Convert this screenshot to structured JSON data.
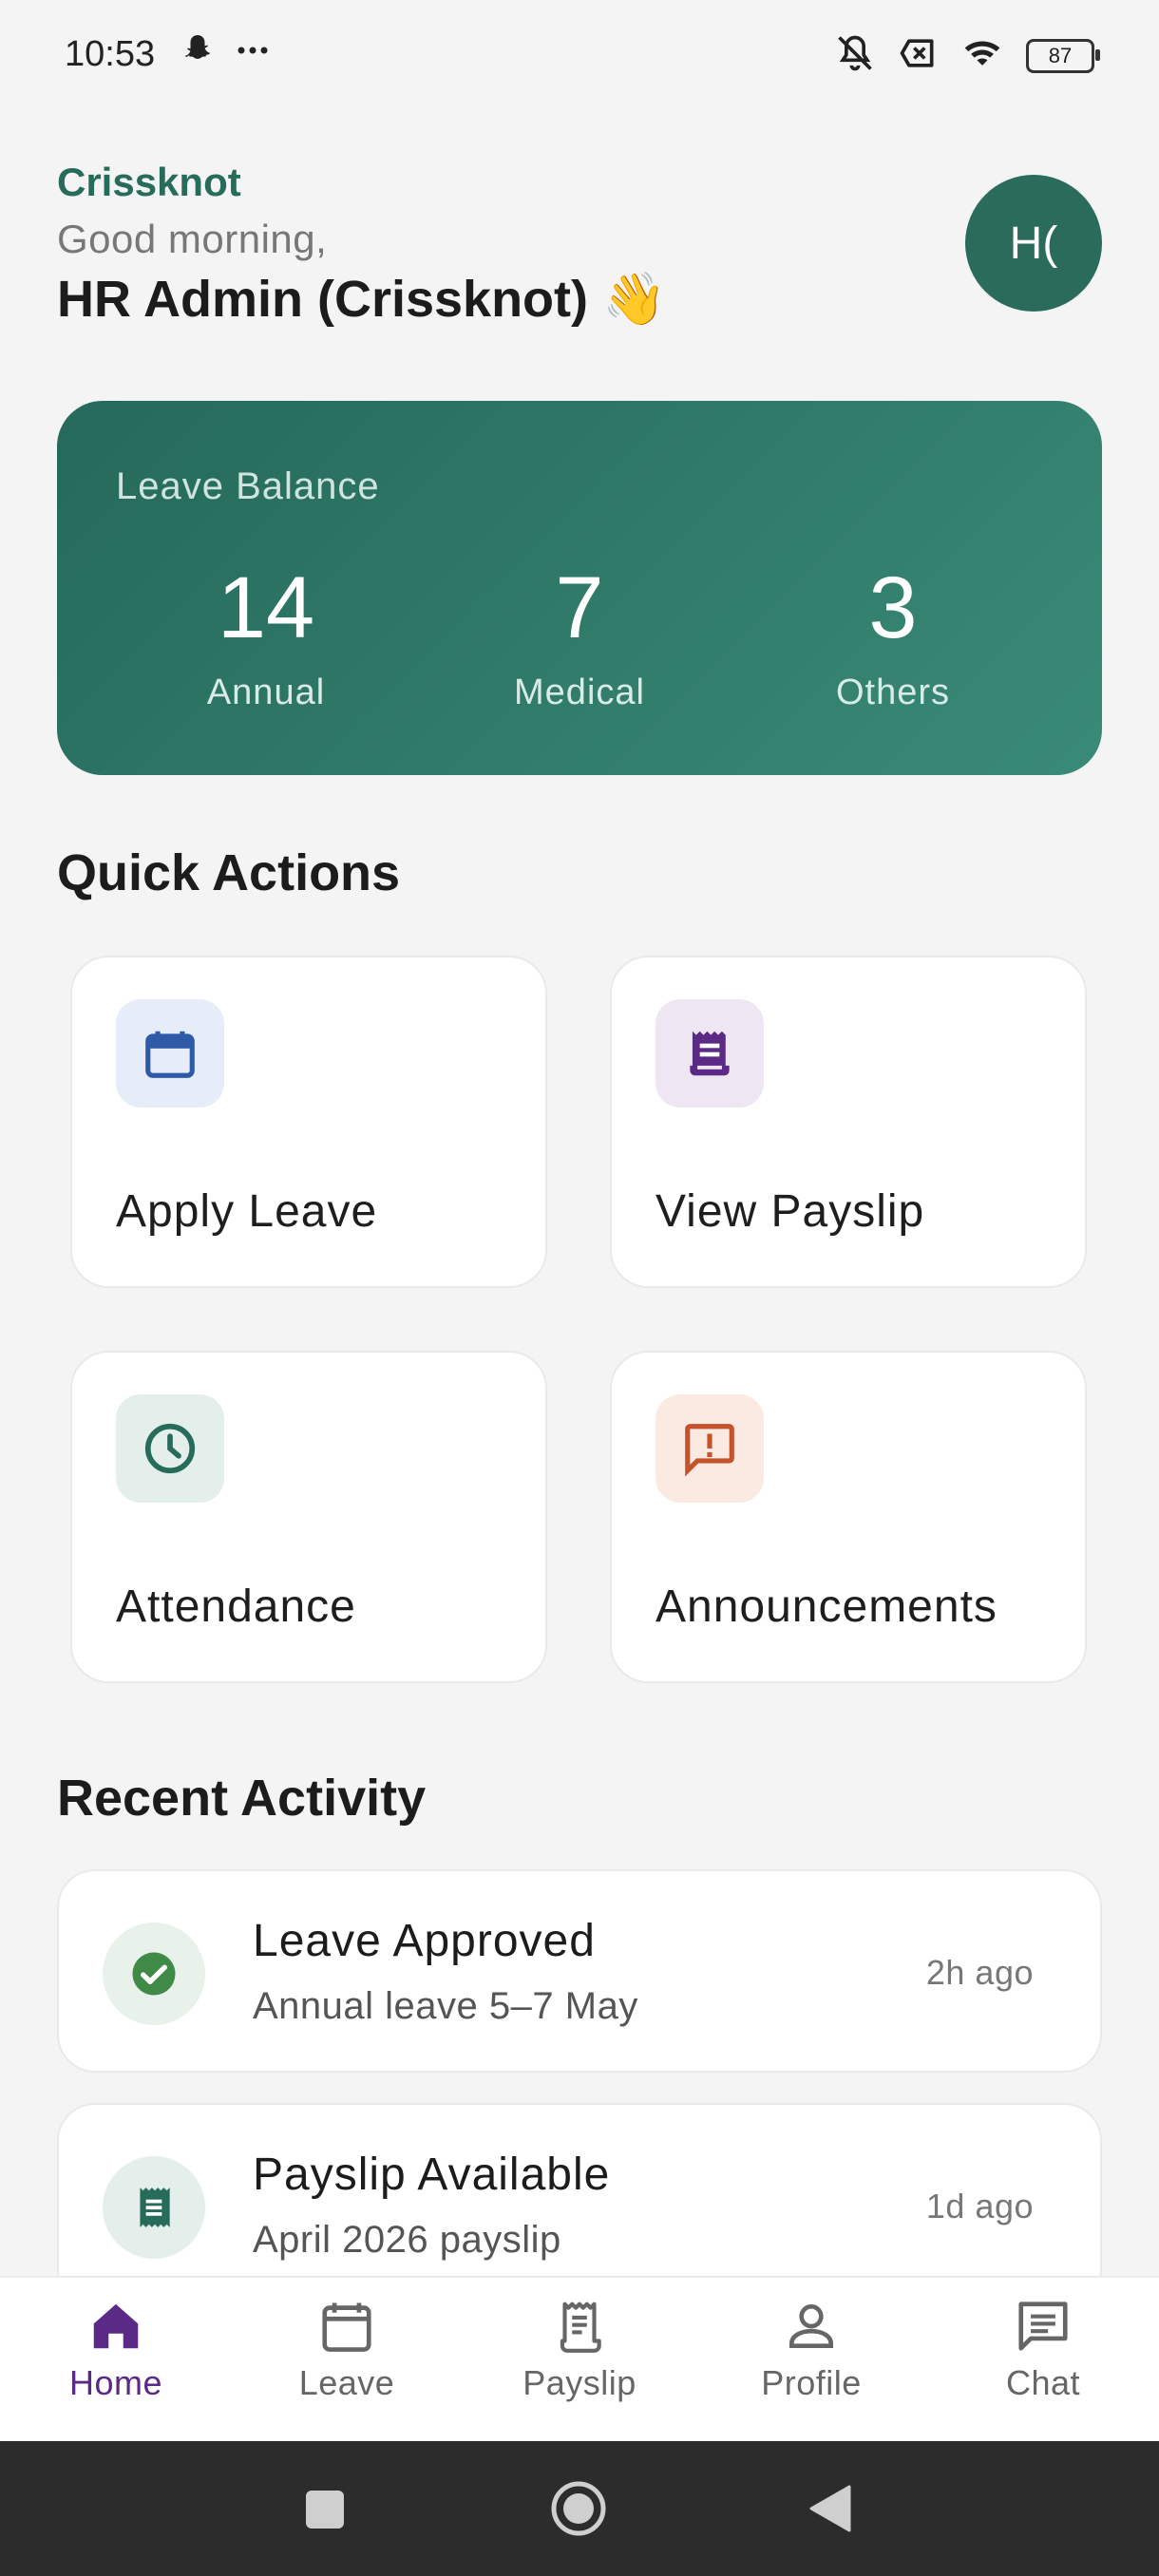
{
  "status_bar": {
    "time": "10:53",
    "left_icons": [
      "snapchat-icon",
      "more-dots-icon"
    ],
    "right_icons": [
      "bell-off-icon",
      "no-sim-icon",
      "wifi-icon",
      "battery-icon"
    ],
    "battery": "87"
  },
  "header": {
    "brand": "Crissknot",
    "greeting": "Good morning,",
    "username": "HR Admin (Crissknot) 👋",
    "avatar_initials": "H("
  },
  "leave_balance": {
    "title": "Leave Balance",
    "items": [
      {
        "value": "14",
        "label": "Annual"
      },
      {
        "value": "7",
        "label": "Medical"
      },
      {
        "value": "3",
        "label": "Others"
      }
    ]
  },
  "quick_actions": {
    "title": "Quick Actions",
    "items": [
      {
        "label": "Apply Leave",
        "icon": "calendar-icon",
        "icon_color": "#2f5aa8",
        "icon_bg": "#e6edf8"
      },
      {
        "label": "View Payslip",
        "icon": "receipt-icon",
        "icon_color": "#5b2a86",
        "icon_bg": "#efe6f4"
      },
      {
        "label": "Attendance",
        "icon": "clock-icon",
        "icon_color": "#276b5b",
        "icon_bg": "#e4efec"
      },
      {
        "label": "Announcements",
        "icon": "announcement-icon",
        "icon_color": "#c4522a",
        "icon_bg": "#fbeae2"
      }
    ]
  },
  "recent_activity": {
    "title": "Recent Activity",
    "items": [
      {
        "title": "Leave Approved",
        "subtitle": "Annual leave 5–7 May",
        "time": "2h ago",
        "icon": "check-circle-icon"
      },
      {
        "title": "Payslip Available",
        "subtitle": "April 2026 payslip",
        "time": "1d ago",
        "icon": "receipt-icon"
      }
    ]
  },
  "bottom_nav": {
    "items": [
      {
        "label": "Home",
        "icon": "home-icon",
        "active": true
      },
      {
        "label": "Leave",
        "icon": "calendar-icon",
        "active": false
      },
      {
        "label": "Payslip",
        "icon": "receipt-icon",
        "active": false
      },
      {
        "label": "Profile",
        "icon": "person-icon",
        "active": false
      },
      {
        "label": "Chat",
        "icon": "chat-icon",
        "active": false
      }
    ]
  },
  "colors": {
    "brand": "#276b5b",
    "active_nav": "#5b2a86",
    "card_gradient_start": "#25695a",
    "card_gradient_end": "#3a8a78"
  }
}
